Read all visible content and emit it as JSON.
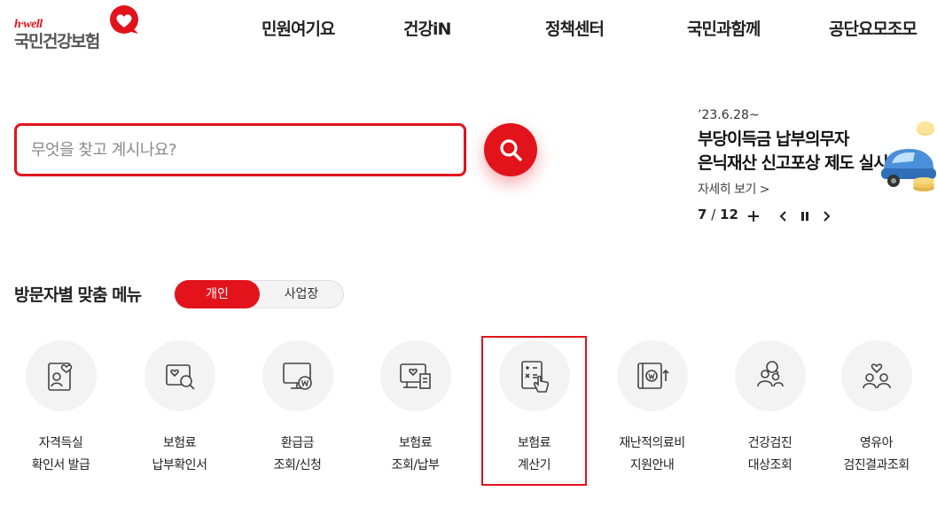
{
  "logo": {
    "tagline": "h·well",
    "name": "국민건강보험"
  },
  "nav": [
    "민원여기요",
    "건강iN",
    "정책센터",
    "국민과함께",
    "공단요모조모"
  ],
  "search": {
    "placeholder": "무엇을 찾고 계시나요?"
  },
  "banner": {
    "date": "’23.6.28~",
    "title_line1": "부당이득금 납부의무자",
    "title_line2": "은닉재산 신고포상 제도 실시",
    "link": "자세히 보기 >",
    "page_current": "7",
    "page_sep": " / ",
    "page_total": "12"
  },
  "visitor_menu": {
    "title": "방문자별 맞춤 메뉴",
    "tab_active": "개인",
    "tab_inactive": "사업장",
    "items": [
      {
        "line1": "자격득실",
        "line2": "확인서 발급",
        "icon": "id-card-heart-icon"
      },
      {
        "line1": "보험료",
        "line2": "납부확인서",
        "icon": "document-search-icon"
      },
      {
        "line1": "환급금",
        "line2": "조회/신청",
        "icon": "monitor-won-icon"
      },
      {
        "line1": "보험료",
        "line2": "조회/납부",
        "icon": "receipt-heart-icon"
      },
      {
        "line1": "보험료",
        "line2": "계산기",
        "icon": "calculator-hand-icon"
      },
      {
        "line1": "재난적의료비",
        "line2": "지원안내",
        "icon": "won-transfer-icon"
      },
      {
        "line1": "건강검진",
        "line2": "대상조회",
        "icon": "people-search-icon"
      },
      {
        "line1": "영유아",
        "line2": "검진결과조회",
        "icon": "family-heart-icon"
      }
    ]
  },
  "colors": {
    "brand": "#e2131b",
    "text": "#222222",
    "circle_bg": "#f3f3f3"
  }
}
